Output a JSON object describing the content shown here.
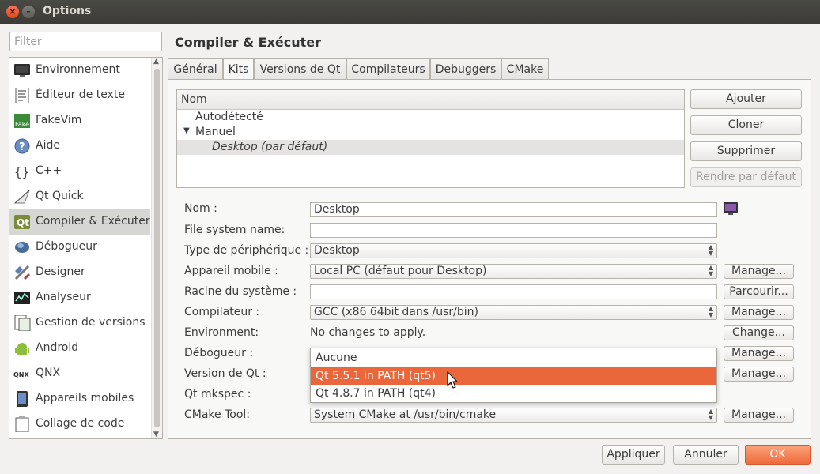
{
  "window": {
    "title": "Options"
  },
  "filter": {
    "placeholder": "Filter",
    "value": ""
  },
  "sidebar": {
    "items": [
      {
        "label": "Environnement",
        "icon": "monitor-icon"
      },
      {
        "label": "Éditeur de texte",
        "icon": "text-editor-icon"
      },
      {
        "label": "FakeVim",
        "icon": "fakevim-icon"
      },
      {
        "label": "Aide",
        "icon": "help-icon"
      },
      {
        "label": "C++",
        "icon": "cpp-braces-icon"
      },
      {
        "label": "Qt Quick",
        "icon": "qt-quick-icon"
      },
      {
        "label": "Compiler & Exécuter",
        "icon": "build-run-icon"
      },
      {
        "label": "Débogueur",
        "icon": "debugger-icon"
      },
      {
        "label": "Designer",
        "icon": "designer-icon"
      },
      {
        "label": "Analyseur",
        "icon": "analyzer-icon"
      },
      {
        "label": "Gestion de versions",
        "icon": "version-control-icon"
      },
      {
        "label": "Android",
        "icon": "android-icon"
      },
      {
        "label": "QNX",
        "icon": "qnx-icon"
      },
      {
        "label": "Appareils mobiles",
        "icon": "mobile-device-icon"
      },
      {
        "label": "Collage de code",
        "icon": "code-paste-icon"
      }
    ],
    "selected": "Compiler & Exécuter"
  },
  "page": {
    "title": "Compiler & Exécuter"
  },
  "tabs": [
    {
      "label": "Général"
    },
    {
      "label": "Kits"
    },
    {
      "label": "Versions de Qt"
    },
    {
      "label": "Compilateurs"
    },
    {
      "label": "Debuggers"
    },
    {
      "label": "CMake"
    }
  ],
  "active_tab": "Kits",
  "kits_tree": {
    "header": "Nom",
    "rows": [
      {
        "label": "Autodétecté",
        "expander": ""
      },
      {
        "label": "Manuel",
        "expander": "▼"
      },
      {
        "label": "Desktop (par défaut)",
        "expander": ""
      }
    ]
  },
  "kit_buttons": {
    "add": "Ajouter",
    "clone": "Cloner",
    "remove": "Supprimer",
    "make_default": "Rendre par défaut"
  },
  "form": {
    "name": {
      "label": "Nom :",
      "value": "Desktop"
    },
    "fs_name": {
      "label": "File system name:",
      "value": ""
    },
    "device_type": {
      "label": "Type de périphérique :",
      "value": "Desktop"
    },
    "device": {
      "label": "Appareil mobile :",
      "value": "Local PC (défaut pour Desktop)",
      "button": "Manage..."
    },
    "sysroot": {
      "label": "Racine du système :",
      "value": "",
      "button": "Parcourir..."
    },
    "compiler": {
      "label": "Compilateur :",
      "value": "GCC (x86 64bit dans /usr/bin)",
      "button": "Manage..."
    },
    "environment": {
      "label": "Environment:",
      "value": "No changes to apply.",
      "button": "Change..."
    },
    "debugger": {
      "label": "Débogueur :",
      "button": "Manage..."
    },
    "qt_version": {
      "label": "Version de Qt :",
      "button": "Manage..."
    },
    "mkspec": {
      "label": "Qt mkspec :"
    },
    "cmake": {
      "label": "CMake Tool:",
      "value": "System CMake at /usr/bin/cmake",
      "button": "Manage..."
    }
  },
  "dropdown": {
    "items": [
      {
        "label": "Aucune"
      },
      {
        "label": "Qt 5.5.1 in PATH (qt5)"
      },
      {
        "label": "Qt 4.8.7 in PATH (qt4)"
      }
    ],
    "highlighted": "Qt 5.5.1 in PATH (qt5)"
  },
  "footer": {
    "apply": "Appliquer",
    "cancel": "Annuler",
    "ok": "OK"
  },
  "colors": {
    "accent": "#e9673a",
    "titlebar": "#3c3b37",
    "selection": "#d6d6d3"
  }
}
